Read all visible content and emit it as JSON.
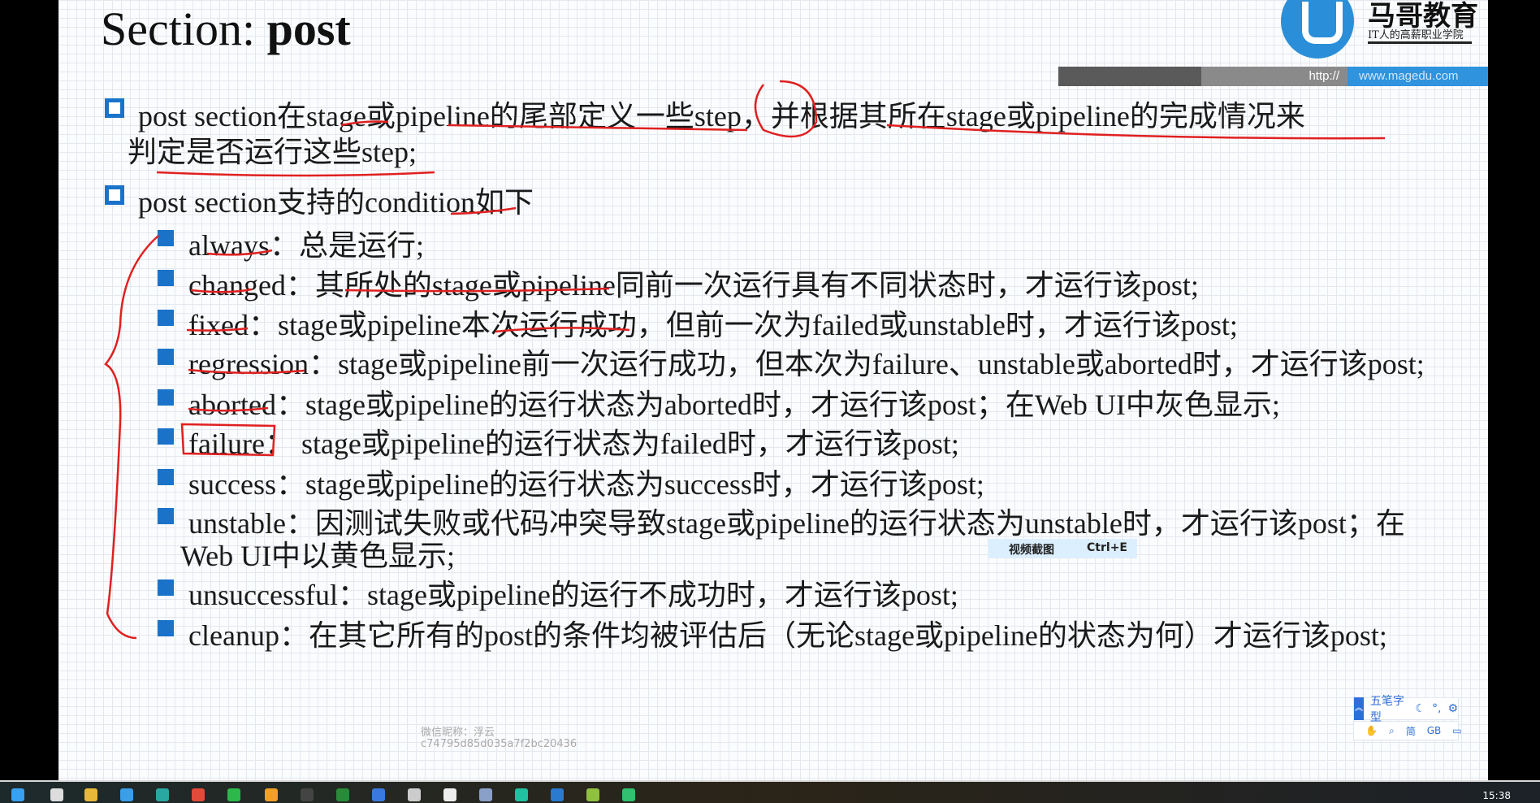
{
  "slide": {
    "title_prefix": "Section: ",
    "title_bold": "post",
    "brand": {
      "name": "马哥教育",
      "slogan": "IT人的高薪职业学院",
      "url_prefix": "http://",
      "url": "www.magedu.com"
    },
    "bullets": [
      {
        "line1": "post section在stage或pipeline的尾部定义一些step，并根据其所在stage或pipeline的完成情况来",
        "line2": "判定是否运行这些step;"
      },
      {
        "line1": "post section支持的condition如下"
      }
    ],
    "conditions": [
      {
        "text": "always：总是运行;"
      },
      {
        "text": "changed：其所处的stage或pipeline同前一次运行具有不同状态时，才运行该post;"
      },
      {
        "text": "fixed：stage或pipeline本次运行成功，但前一次为failed或unstable时，才运行该post;"
      },
      {
        "text": "regression：stage或pipeline前一次运行成功，但本次为failure、unstable或aborted时，才运行该post;"
      },
      {
        "text": "aborted：stage或pipeline的运行状态为aborted时，才运行该post；在Web UI中灰色显示;"
      },
      {
        "text": "failure：  stage或pipeline的运行状态为failed时，才运行该post;"
      },
      {
        "text": "success：stage或pipeline的运行状态为success时，才运行该post;"
      },
      {
        "text": "unstable：因测试失败或代码冲突导致stage或pipeline的运行状态为unstable时，才运行该post；在",
        "text2": "Web UI中以黄色显示;"
      },
      {
        "text": "unsuccessful：stage或pipeline的运行不成功时，才运行该post;"
      },
      {
        "text": "cleanup：在其它所有的post的条件均被评估后（无论stage或pipeline的状态为何）才运行该post;"
      }
    ],
    "watermark": {
      "line1": "微信昵称：浮云",
      "line2": "c74795d85d035a7f2bc20436"
    }
  },
  "tooltip": {
    "label": "视频截图",
    "shortcut": "Ctrl+E"
  },
  "ime": {
    "mode": "五笔字型",
    "punct": "°,",
    "simplified": "简",
    "charset": "GB"
  },
  "taskbar": {
    "time": "15:38"
  },
  "colors": {
    "accent": "#1a73c8",
    "annotation": "#e02020",
    "url_bar": "#2f93de"
  }
}
